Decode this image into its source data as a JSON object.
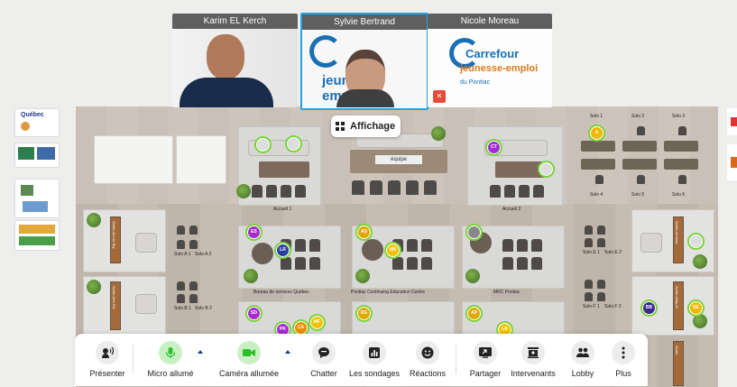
{
  "participants": [
    {
      "name": "Karim EL Kerch"
    },
    {
      "name": "Sylvie Bertrand"
    },
    {
      "name": "Nicole Moreau"
    }
  ],
  "logo": {
    "brand": "Carrefour",
    "line1": "jeunesse-emploi",
    "line2": "du Pontiac"
  },
  "affichage_label": "Affichage",
  "toolbar": {
    "presenter": "Présenter",
    "micro": "Micro allumé",
    "camera": "Caméra allumée",
    "chatter": "Chatter",
    "sondages": "Les sondages",
    "reactions": "Réactions",
    "partager": "Partager",
    "intervenants": "Intervenants",
    "lobby": "Lobby",
    "plus": "Plus"
  },
  "zones": {
    "accueil1": "Accueil 1",
    "accueil2": "Accueil 2",
    "equipe": "équipe",
    "bureau": "Bureau de services Québec",
    "pontiac": "Pontiac Continuing Education Centre",
    "mrc": "MRC Pontiac",
    "solo1": "Solo 1",
    "solo2": "Solo 2",
    "solo3": "Solo 3",
    "solo4": "Solo 4",
    "solo5": "Solo 5",
    "solo6": "Solo 6",
    "soloA1": "Solo A 1",
    "soloA2": "Solo A 2",
    "soloB1": "Solo B 1",
    "soloB2": "Solo B 2",
    "soloE1": "Solo E 1",
    "soloE2": "Solo E 2",
    "soloF1": "Solo F 1",
    "soloF2": "Solo F 2"
  },
  "banners": {
    "lac": "Sortie du Lac Bry",
    "fer": "Sortie Arm Fer",
    "bras": "Sortie du Bras",
    "allay": "Sortie Allay-ei",
    "sorties": "Sortie"
  },
  "sponsors": {
    "quebec": "Québec"
  },
  "avatars": {
    "a": "A",
    "ct": "CT",
    "es": "ES",
    "lr": "LR",
    "as": "AS",
    "ms": "MS",
    "sd": "SD",
    "pk": "PK",
    "ca": "CA",
    "mf": "MF",
    "dg": "DG",
    "ap": "AP",
    "lb": "LB",
    "bb": "BB",
    "se": "SE"
  },
  "colors": {
    "accent_green": "#2bbf2b",
    "toolbar_icon_bg": "#ececec",
    "carrefour_blue": "#1a6fb5"
  }
}
